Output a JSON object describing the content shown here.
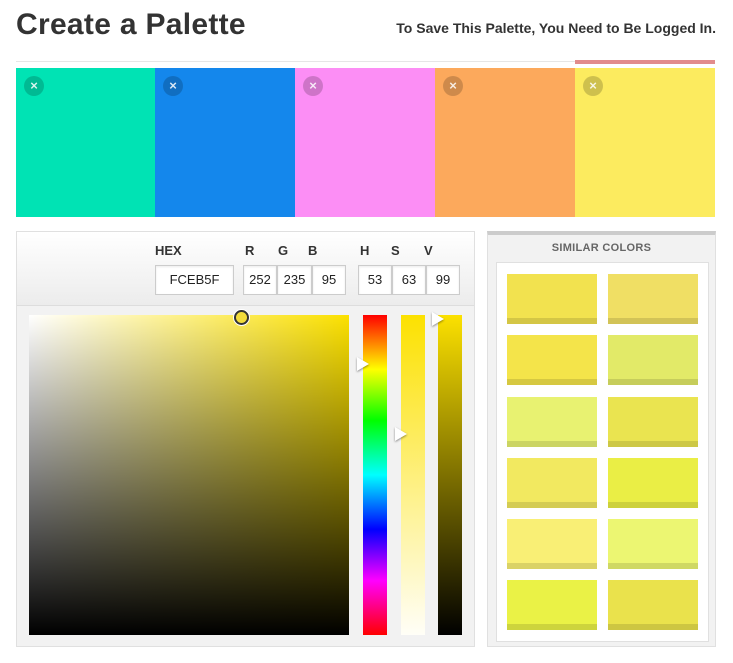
{
  "header": {
    "title": "Create a Palette",
    "login_note": "To Save This Palette, You Need to Be Logged In."
  },
  "palette": {
    "selected_index": 4,
    "swatches": [
      {
        "color": "#00e3b4",
        "remove_icon": "close-icon",
        "remove_glyph": "×"
      },
      {
        "color": "#1487ec",
        "remove_icon": "close-icon",
        "remove_glyph": "×"
      },
      {
        "color": "#fc8ef5",
        "remove_icon": "close-icon",
        "remove_glyph": "×"
      },
      {
        "color": "#fca95c",
        "remove_icon": "close-icon",
        "remove_glyph": "×"
      },
      {
        "color": "#fceb5f",
        "remove_icon": "close-icon",
        "remove_glyph": "×"
      }
    ]
  },
  "picker": {
    "labels": {
      "hex": "HEX",
      "r": "R",
      "g": "G",
      "b": "B",
      "h": "H",
      "s": "S",
      "v": "V"
    },
    "values": {
      "hex": "FCEB5F",
      "r": "252",
      "g": "235",
      "b": "95",
      "h": "53",
      "s": "63",
      "v": "99"
    },
    "hue_color": "#fce100"
  },
  "similar": {
    "title": "SIMILAR COLORS",
    "colors": [
      "#f2e24f",
      "#f0df64",
      "#f4e44a",
      "#e2ea68",
      "#e8f271",
      "#eae450",
      "#f2e960",
      "#eaee45",
      "#f9ef75",
      "#ecf672",
      "#eaf246",
      "#eae24c"
    ]
  }
}
